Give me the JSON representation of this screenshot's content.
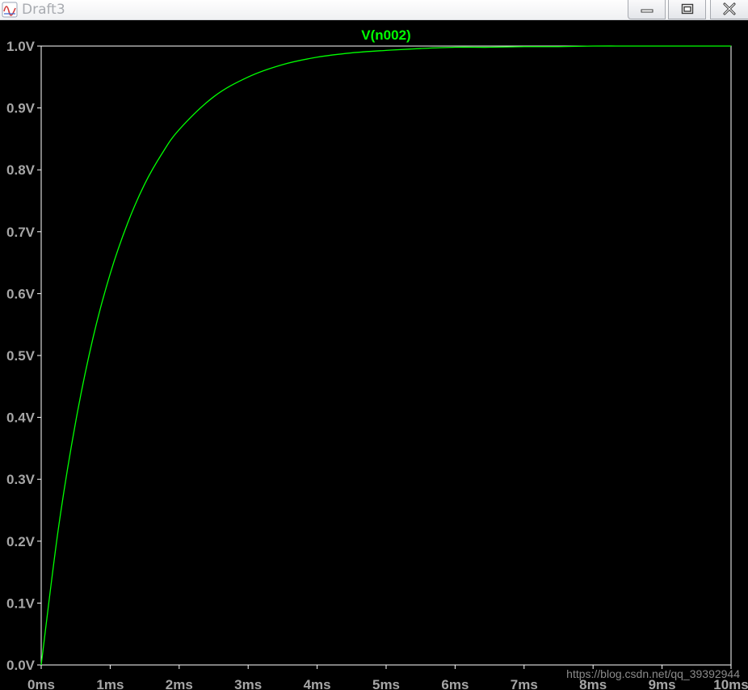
{
  "window": {
    "title": "Draft3"
  },
  "icons": {
    "app": "waveform-app-icon",
    "minimize": "minimize-icon",
    "maximize": "maximize-icon",
    "close": "close-icon"
  },
  "colors": {
    "background": "#000000",
    "trace": "#00ff00",
    "frame": "#ffffff",
    "tick_labels": "#a6a6a6",
    "trace_title": "#00ff00",
    "watermark": "#8a8a8a"
  },
  "watermark": "https://blog.csdn.net/qq_39392944",
  "chart_data": {
    "type": "line",
    "title": "",
    "xlabel": "",
    "ylabel": "",
    "grid": false,
    "legend": "top-center",
    "xlim": [
      0,
      10
    ],
    "ylim": [
      0,
      1
    ],
    "x_unit": "ms",
    "y_unit": "V",
    "x_tick_labels": [
      "0ms",
      "1ms",
      "2ms",
      "3ms",
      "4ms",
      "5ms",
      "6ms",
      "7ms",
      "8ms",
      "9ms",
      "10ms"
    ],
    "y_tick_labels": [
      "0.0V",
      "0.1V",
      "0.2V",
      "0.3V",
      "0.4V",
      "0.5V",
      "0.6V",
      "0.7V",
      "0.8V",
      "0.9V",
      "1.0V"
    ],
    "x_ticks": [
      0,
      1,
      2,
      3,
      4,
      5,
      6,
      7,
      8,
      9,
      10
    ],
    "y_ticks": [
      0,
      0.1,
      0.2,
      0.3,
      0.4,
      0.5,
      0.6,
      0.7,
      0.8,
      0.9,
      1.0
    ],
    "series": [
      {
        "name": "V(n002)",
        "x": [
          0,
          0.25,
          0.5,
          0.75,
          1.0,
          1.25,
          1.5,
          1.75,
          2.0,
          2.5,
          3.0,
          3.5,
          4.0,
          4.5,
          5.0,
          5.5,
          6.0,
          6.5,
          7.0,
          7.5,
          8.0,
          8.5,
          9.0,
          9.5,
          10.0
        ],
        "y": [
          0,
          0.221,
          0.393,
          0.528,
          0.632,
          0.713,
          0.777,
          0.826,
          0.865,
          0.918,
          0.95,
          0.97,
          0.982,
          0.989,
          0.993,
          0.996,
          0.998,
          0.998,
          0.999,
          0.999,
          1.0,
          1.0,
          1.0,
          1.0,
          1.0
        ]
      }
    ]
  }
}
